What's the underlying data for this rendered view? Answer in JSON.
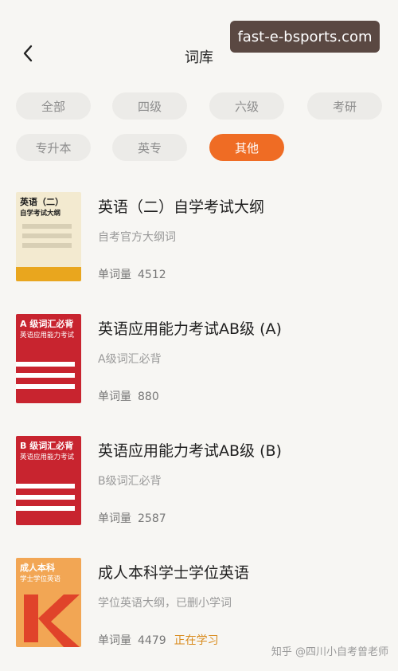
{
  "header": {
    "title": "词库",
    "back_icon": "chevron-left-icon"
  },
  "overlay": {
    "site": "fast-e-bsports.com"
  },
  "filters": [
    {
      "label": "全部",
      "active": false
    },
    {
      "label": "四级",
      "active": false
    },
    {
      "label": "六级",
      "active": false
    },
    {
      "label": "考研",
      "active": false
    },
    {
      "label": "专升本",
      "active": false
    },
    {
      "label": "英专",
      "active": false
    },
    {
      "label": "其他",
      "active": true
    }
  ],
  "books": [
    {
      "cover_title": "英语（二）",
      "cover_sub": "自学考试大纲",
      "title": "英语（二）自学考试大纲",
      "desc": "自考官方大纲词",
      "count_label": "单词量",
      "count": "4512",
      "status": ""
    },
    {
      "cover_title": "A 级词汇必背",
      "cover_sub": "英语应用能力考试",
      "title": "英语应用能力考试AB级 (A)",
      "desc": "A级词汇必背",
      "count_label": "单词量",
      "count": "880",
      "status": ""
    },
    {
      "cover_title": "B 级词汇必背",
      "cover_sub": "英语应用能力考试",
      "title": "英语应用能力考试AB级 (B)",
      "desc": "B级词汇必背",
      "count_label": "单词量",
      "count": "2587",
      "status": ""
    },
    {
      "cover_title": "成人本科",
      "cover_sub": "学士学位英语",
      "title": "成人本科学士学位英语",
      "desc": "学位英语大纲，已删小学词",
      "count_label": "单词量",
      "count": "4479",
      "status": "正在学习"
    }
  ],
  "footer": {
    "watermark": "知乎 @四川小自考曾老师"
  },
  "colors": {
    "accent": "#ef6c24",
    "chip_bg": "#ecebe8",
    "cover_red": "#c8242f",
    "cover_yellow": "#e9a61e",
    "cover_orange": "#f2a654"
  }
}
